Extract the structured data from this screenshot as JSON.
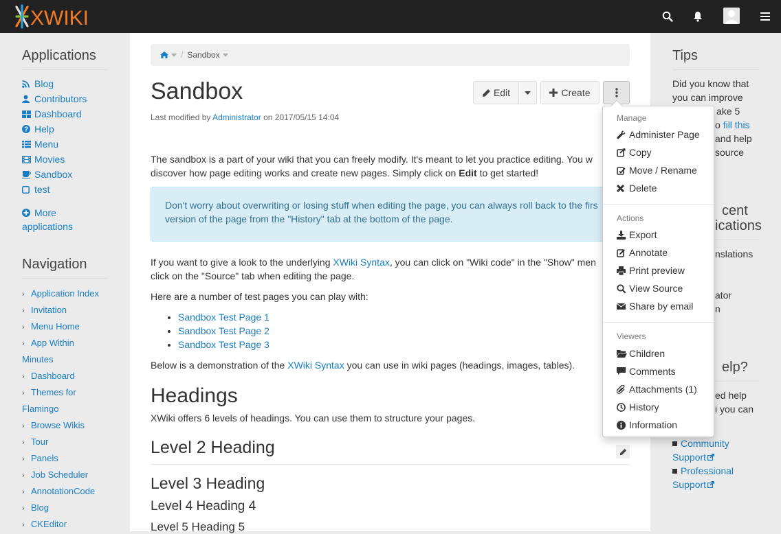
{
  "topbar": {
    "logo_text": "XWIKI",
    "search_icon": "search-icon",
    "notifications_icon": "bell-icon",
    "menu_icon": "hamburger-icon"
  },
  "left_panel": {
    "applications_title": "Applications",
    "applications": [
      {
        "label": "Blog",
        "icon": "rss-icon"
      },
      {
        "label": "Contributors",
        "icon": "user-icon"
      },
      {
        "label": "Dashboard",
        "icon": "dashboard-icon"
      },
      {
        "label": "Help",
        "icon": "question-icon"
      },
      {
        "label": "Menu",
        "icon": "list-icon"
      },
      {
        "label": "Movies",
        "icon": "film-icon"
      },
      {
        "label": "Sandbox",
        "icon": "coffee-icon"
      },
      {
        "label": "test",
        "icon": "square-icon"
      }
    ],
    "more_applications": "More applications",
    "navigation_title": "Navigation",
    "navigation": [
      "Application Index",
      "Invitation",
      "Menu Home",
      "App Within Minutes",
      "Dashboard",
      "Themes for Flamingo",
      "Browse Wikis",
      "Tour",
      "Panels",
      "Job Scheduler",
      "AnnotationCode",
      "Blog",
      "CKEditor"
    ]
  },
  "breadcrumb": {
    "current": "Sandbox"
  },
  "page": {
    "title": "Sandbox",
    "modified_prefix": "Last modified by ",
    "modified_author": "Administrator",
    "modified_suffix": " on 2017/05/15 14:04",
    "edit_label": "Edit",
    "create_label": "Create",
    "intro_1": "The sandbox is a part of your wiki that you can freely modify. It's meant to let you practice editing. You w",
    "intro_2a": "discover how page editing works and create new pages. Simply click on ",
    "intro_2b": "Edit",
    "intro_2c": " to get started!",
    "info_1": "Don't worry about overwriting or losing stuff when editing the page, you can always roll back to the firs",
    "info_2": "version of the page from the \"History\" tab at the bottom of the page.",
    "syntax_1a": "If you want to give a look to the underlying ",
    "syntax_1b": "XWiki Syntax",
    "syntax_1c": ", you can click on \"Wiki code\" in the \"Show\" men",
    "syntax_2": "click on the \"Source\" tab when editing the page.",
    "test_pages_intro": "Here are a number of test pages you can play with:",
    "test_pages": [
      "Sandbox Test Page 1",
      "Sandbox Test Page 2",
      "Sandbox Test Page 3"
    ],
    "demo_a": "Below is a demonstration of the ",
    "demo_b": "XWiki Syntax",
    "demo_c": " you can use in wiki pages (headings, images, tables).",
    "headings_title": "Headings",
    "headings_text": "XWiki offers 6 levels of headings. You can use them to structure your pages.",
    "level2": "Level 2 Heading",
    "level3": "Level 3 Heading",
    "level4": "Level 4 Heading 4",
    "level5": "Level 5 Heading 5"
  },
  "right_panel": {
    "tips_title": "Tips",
    "tips_lines": [
      "Did you know that",
      "you can improve",
      "ake 5",
      "o",
      "and help",
      "source"
    ],
    "tips_link": "fill this",
    "recent_title_1": "cent",
    "recent_title_2": "ications",
    "recent_link_1": "nslations",
    "recent_link_2": "ator",
    "recent_link_3": "n",
    "help_title": "elp?",
    "help_line_1": "ed help",
    "help_line_2": "i you can",
    "community_support": "Community Support",
    "professional_support": "Professional Support"
  },
  "dropdown": {
    "manage_header": "Manage",
    "manage_items": [
      {
        "label": "Administer Page",
        "icon": "wrench-icon"
      },
      {
        "label": "Copy",
        "icon": "copy-icon"
      },
      {
        "label": "Move / Rename",
        "icon": "move-icon"
      },
      {
        "label": "Delete",
        "icon": "delete-icon"
      }
    ],
    "actions_header": "Actions",
    "actions_items": [
      {
        "label": "Export",
        "icon": "download-icon"
      },
      {
        "label": "Annotate",
        "icon": "annotate-icon"
      },
      {
        "label": "Print preview",
        "icon": "print-icon"
      },
      {
        "label": "View Source",
        "icon": "search-icon"
      },
      {
        "label": "Share by email",
        "icon": "envelope-icon"
      }
    ],
    "viewers_header": "Viewers",
    "viewers_items": [
      {
        "label": "Children",
        "icon": "folder-icon"
      },
      {
        "label": "Comments",
        "icon": "comment-icon"
      },
      {
        "label": "Attachments (1)",
        "icon": "paperclip-icon"
      },
      {
        "label": "History",
        "icon": "clock-icon"
      },
      {
        "label": "Information",
        "icon": "info-icon"
      }
    ]
  }
}
